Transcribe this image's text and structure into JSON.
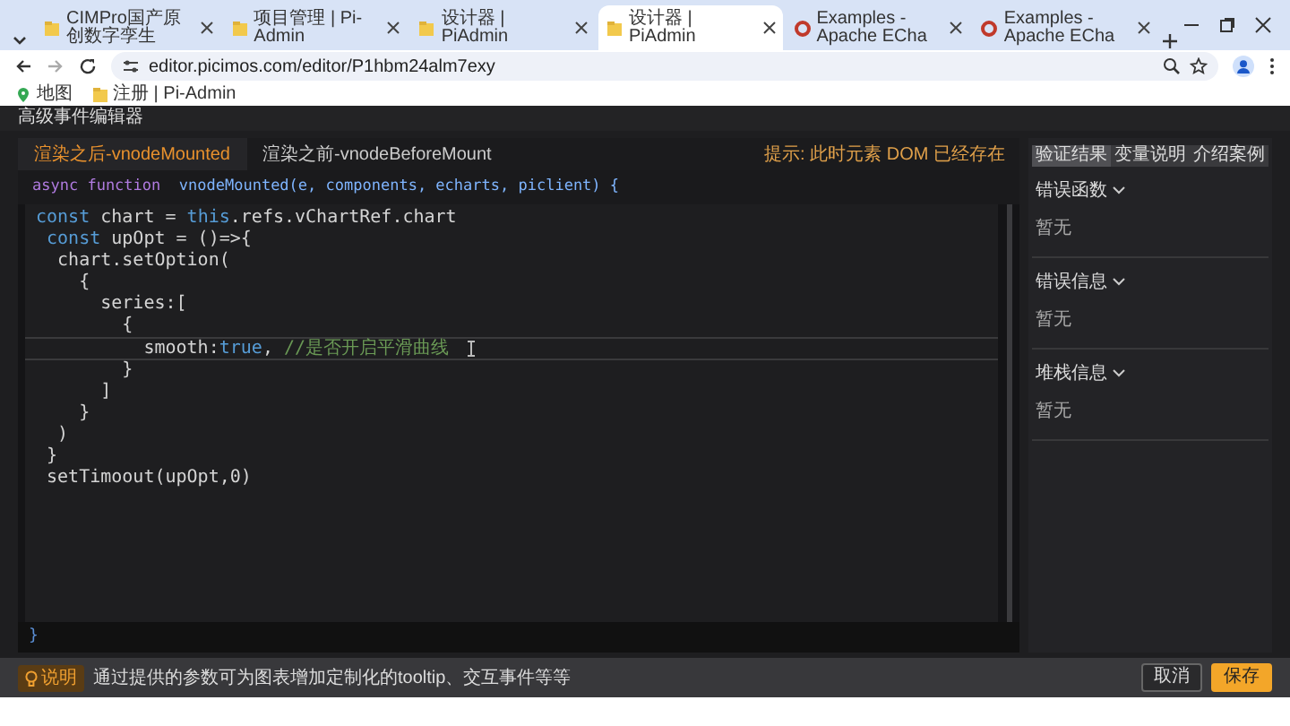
{
  "browser": {
    "tabs": [
      {
        "title": "CIMPro国产原创数字孪生",
        "kind": "folder",
        "selected": false
      },
      {
        "title": "项目管理 | Pi-Admin",
        "kind": "folder",
        "selected": false
      },
      {
        "title": "设计器 | PiAdmin",
        "kind": "folder",
        "selected": false
      },
      {
        "title": "设计器 | PiAdmin",
        "kind": "folder",
        "selected": true
      },
      {
        "title": "Examples - Apache ECha",
        "kind": "ring",
        "selected": false
      },
      {
        "title": "Examples - Apache ECha",
        "kind": "ring",
        "selected": false
      }
    ],
    "address": "editor.picimos.com/editor/P1hbm24alm7exy",
    "bookmarks": [
      {
        "label": "地图",
        "kind": "maps"
      },
      {
        "label": "注册 | Pi-Admin",
        "kind": "folder"
      }
    ]
  },
  "editor": {
    "title": "高级事件编辑器",
    "tabs": [
      {
        "label": "渲染之后-vnodeMounted",
        "selected": true
      },
      {
        "label": "渲染之前-vnodeBeforeMount",
        "selected": false
      }
    ],
    "hint": "提示: 此时元素 DOM 已经存在",
    "signature": [
      {
        "kind": "kw",
        "text": "async function  "
      },
      {
        "kind": "fn",
        "text": "vnodeMounted(e, components, echarts, piclient) {"
      }
    ],
    "lines": [
      {
        "active": false,
        "tokens": [
          {
            "kind": "kw",
            "text": "const"
          },
          {
            "kind": "plain",
            "text": " chart = "
          },
          {
            "kind": "kw",
            "text": "this"
          },
          {
            "kind": "plain",
            "text": ".refs.vChartRef.chart"
          }
        ]
      },
      {
        "active": false,
        "tokens": [
          {
            "kind": "kw",
            "text": " const"
          },
          {
            "kind": "plain",
            "text": " upOpt = ()=>{"
          }
        ]
      },
      {
        "active": false,
        "tokens": [
          {
            "kind": "plain",
            "text": "  chart.setOption("
          }
        ]
      },
      {
        "active": false,
        "tokens": [
          {
            "kind": "plain",
            "text": "    {"
          }
        ]
      },
      {
        "active": false,
        "tokens": [
          {
            "kind": "plain",
            "text": "      series:["
          }
        ]
      },
      {
        "active": false,
        "tokens": [
          {
            "kind": "plain",
            "text": "        {"
          }
        ]
      },
      {
        "active": true,
        "tokens": [
          {
            "kind": "plain",
            "text": "          smooth:"
          },
          {
            "kind": "kw",
            "text": "true"
          },
          {
            "kind": "plain",
            "text": ", "
          },
          {
            "kind": "comment",
            "text": "//是否开启平滑曲线"
          }
        ]
      },
      {
        "active": false,
        "tokens": [
          {
            "kind": "plain",
            "text": "        }"
          }
        ]
      },
      {
        "active": false,
        "tokens": [
          {
            "kind": "plain",
            "text": "      ]"
          }
        ]
      },
      {
        "active": false,
        "tokens": [
          {
            "kind": "plain",
            "text": "    }"
          }
        ]
      },
      {
        "active": false,
        "tokens": [
          {
            "kind": "plain",
            "text": "  )"
          }
        ]
      },
      {
        "active": false,
        "tokens": [
          {
            "kind": "plain",
            "text": " }"
          }
        ]
      },
      {
        "active": false,
        "tokens": [
          {
            "kind": "plain",
            "text": " setTimoout(upOpt,0)"
          }
        ]
      }
    ],
    "closing": "}"
  },
  "side": {
    "tabs": [
      {
        "label": "验证结果",
        "selected": true
      },
      {
        "label": "变量说明",
        "selected": false
      },
      {
        "label": "介绍案例",
        "selected": false
      }
    ],
    "sections": [
      {
        "title": "错误函数",
        "body": "暂无"
      },
      {
        "title": "错误信息",
        "body": "暂无"
      },
      {
        "title": "堆栈信息",
        "body": "暂无"
      }
    ]
  },
  "footer": {
    "badge": "说明",
    "note": "通过提供的参数可为图表增加定制化的tooltip、交互事件等等",
    "buttons": [
      {
        "label": "取消",
        "kind": "secondary"
      },
      {
        "label": "保存",
        "kind": "primary"
      }
    ]
  }
}
